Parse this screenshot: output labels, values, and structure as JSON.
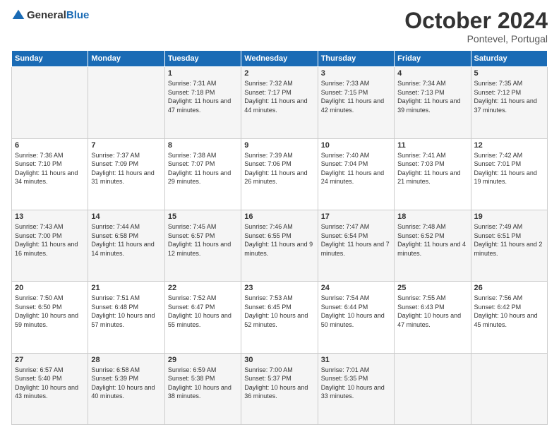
{
  "logo": {
    "general": "General",
    "blue": "Blue"
  },
  "title": {
    "month": "October 2024",
    "location": "Pontevel, Portugal"
  },
  "days_of_week": [
    "Sunday",
    "Monday",
    "Tuesday",
    "Wednesday",
    "Thursday",
    "Friday",
    "Saturday"
  ],
  "weeks": [
    [
      {
        "day": "",
        "sunrise": "",
        "sunset": "",
        "daylight": ""
      },
      {
        "day": "",
        "sunrise": "",
        "sunset": "",
        "daylight": ""
      },
      {
        "day": "1",
        "sunrise": "Sunrise: 7:31 AM",
        "sunset": "Sunset: 7:18 PM",
        "daylight": "Daylight: 11 hours and 47 minutes."
      },
      {
        "day": "2",
        "sunrise": "Sunrise: 7:32 AM",
        "sunset": "Sunset: 7:17 PM",
        "daylight": "Daylight: 11 hours and 44 minutes."
      },
      {
        "day": "3",
        "sunrise": "Sunrise: 7:33 AM",
        "sunset": "Sunset: 7:15 PM",
        "daylight": "Daylight: 11 hours and 42 minutes."
      },
      {
        "day": "4",
        "sunrise": "Sunrise: 7:34 AM",
        "sunset": "Sunset: 7:13 PM",
        "daylight": "Daylight: 11 hours and 39 minutes."
      },
      {
        "day": "5",
        "sunrise": "Sunrise: 7:35 AM",
        "sunset": "Sunset: 7:12 PM",
        "daylight": "Daylight: 11 hours and 37 minutes."
      }
    ],
    [
      {
        "day": "6",
        "sunrise": "Sunrise: 7:36 AM",
        "sunset": "Sunset: 7:10 PM",
        "daylight": "Daylight: 11 hours and 34 minutes."
      },
      {
        "day": "7",
        "sunrise": "Sunrise: 7:37 AM",
        "sunset": "Sunset: 7:09 PM",
        "daylight": "Daylight: 11 hours and 31 minutes."
      },
      {
        "day": "8",
        "sunrise": "Sunrise: 7:38 AM",
        "sunset": "Sunset: 7:07 PM",
        "daylight": "Daylight: 11 hours and 29 minutes."
      },
      {
        "day": "9",
        "sunrise": "Sunrise: 7:39 AM",
        "sunset": "Sunset: 7:06 PM",
        "daylight": "Daylight: 11 hours and 26 minutes."
      },
      {
        "day": "10",
        "sunrise": "Sunrise: 7:40 AM",
        "sunset": "Sunset: 7:04 PM",
        "daylight": "Daylight: 11 hours and 24 minutes."
      },
      {
        "day": "11",
        "sunrise": "Sunrise: 7:41 AM",
        "sunset": "Sunset: 7:03 PM",
        "daylight": "Daylight: 11 hours and 21 minutes."
      },
      {
        "day": "12",
        "sunrise": "Sunrise: 7:42 AM",
        "sunset": "Sunset: 7:01 PM",
        "daylight": "Daylight: 11 hours and 19 minutes."
      }
    ],
    [
      {
        "day": "13",
        "sunrise": "Sunrise: 7:43 AM",
        "sunset": "Sunset: 7:00 PM",
        "daylight": "Daylight: 11 hours and 16 minutes."
      },
      {
        "day": "14",
        "sunrise": "Sunrise: 7:44 AM",
        "sunset": "Sunset: 6:58 PM",
        "daylight": "Daylight: 11 hours and 14 minutes."
      },
      {
        "day": "15",
        "sunrise": "Sunrise: 7:45 AM",
        "sunset": "Sunset: 6:57 PM",
        "daylight": "Daylight: 11 hours and 12 minutes."
      },
      {
        "day": "16",
        "sunrise": "Sunrise: 7:46 AM",
        "sunset": "Sunset: 6:55 PM",
        "daylight": "Daylight: 11 hours and 9 minutes."
      },
      {
        "day": "17",
        "sunrise": "Sunrise: 7:47 AM",
        "sunset": "Sunset: 6:54 PM",
        "daylight": "Daylight: 11 hours and 7 minutes."
      },
      {
        "day": "18",
        "sunrise": "Sunrise: 7:48 AM",
        "sunset": "Sunset: 6:52 PM",
        "daylight": "Daylight: 11 hours and 4 minutes."
      },
      {
        "day": "19",
        "sunrise": "Sunrise: 7:49 AM",
        "sunset": "Sunset: 6:51 PM",
        "daylight": "Daylight: 11 hours and 2 minutes."
      }
    ],
    [
      {
        "day": "20",
        "sunrise": "Sunrise: 7:50 AM",
        "sunset": "Sunset: 6:50 PM",
        "daylight": "Daylight: 10 hours and 59 minutes."
      },
      {
        "day": "21",
        "sunrise": "Sunrise: 7:51 AM",
        "sunset": "Sunset: 6:48 PM",
        "daylight": "Daylight: 10 hours and 57 minutes."
      },
      {
        "day": "22",
        "sunrise": "Sunrise: 7:52 AM",
        "sunset": "Sunset: 6:47 PM",
        "daylight": "Daylight: 10 hours and 55 minutes."
      },
      {
        "day": "23",
        "sunrise": "Sunrise: 7:53 AM",
        "sunset": "Sunset: 6:45 PM",
        "daylight": "Daylight: 10 hours and 52 minutes."
      },
      {
        "day": "24",
        "sunrise": "Sunrise: 7:54 AM",
        "sunset": "Sunset: 6:44 PM",
        "daylight": "Daylight: 10 hours and 50 minutes."
      },
      {
        "day": "25",
        "sunrise": "Sunrise: 7:55 AM",
        "sunset": "Sunset: 6:43 PM",
        "daylight": "Daylight: 10 hours and 47 minutes."
      },
      {
        "day": "26",
        "sunrise": "Sunrise: 7:56 AM",
        "sunset": "Sunset: 6:42 PM",
        "daylight": "Daylight: 10 hours and 45 minutes."
      }
    ],
    [
      {
        "day": "27",
        "sunrise": "Sunrise: 6:57 AM",
        "sunset": "Sunset: 5:40 PM",
        "daylight": "Daylight: 10 hours and 43 minutes."
      },
      {
        "day": "28",
        "sunrise": "Sunrise: 6:58 AM",
        "sunset": "Sunset: 5:39 PM",
        "daylight": "Daylight: 10 hours and 40 minutes."
      },
      {
        "day": "29",
        "sunrise": "Sunrise: 6:59 AM",
        "sunset": "Sunset: 5:38 PM",
        "daylight": "Daylight: 10 hours and 38 minutes."
      },
      {
        "day": "30",
        "sunrise": "Sunrise: 7:00 AM",
        "sunset": "Sunset: 5:37 PM",
        "daylight": "Daylight: 10 hours and 36 minutes."
      },
      {
        "day": "31",
        "sunrise": "Sunrise: 7:01 AM",
        "sunset": "Sunset: 5:35 PM",
        "daylight": "Daylight: 10 hours and 33 minutes."
      },
      {
        "day": "",
        "sunrise": "",
        "sunset": "",
        "daylight": ""
      },
      {
        "day": "",
        "sunrise": "",
        "sunset": "",
        "daylight": ""
      }
    ]
  ]
}
